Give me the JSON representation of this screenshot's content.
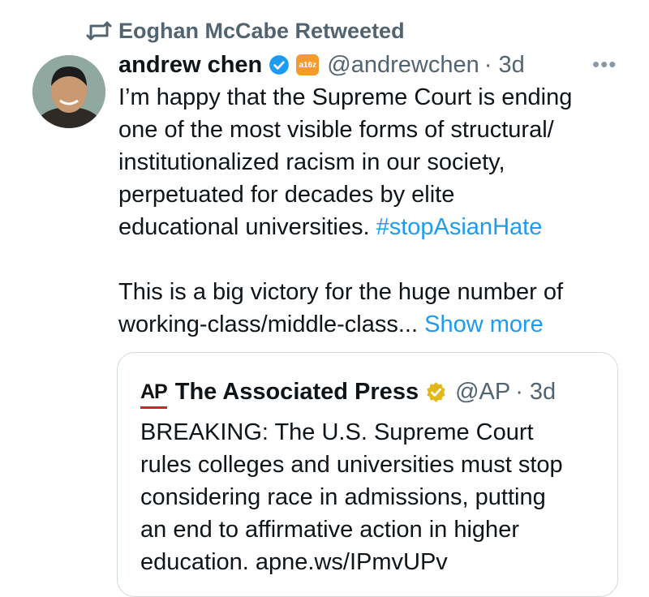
{
  "retweet": {
    "label": "Eoghan McCabe Retweeted"
  },
  "tweet": {
    "author_name": "andrew chen",
    "org_badge": "a16z",
    "handle": "@andrewchen",
    "time": "· 3d",
    "more": "•••",
    "lines": [
      "I’m happy that the Supreme Court is ending",
      "one of the most visible forms of structural/",
      "institutionalized racism in our society,",
      "perpetuated for decades by elite"
    ],
    "line5_text": "educational universities.",
    "hashtag": "#stopAsianHate",
    "line6": "This is a big victory for the huge number of",
    "line7_text": "working-class/middle-class...",
    "show_more": "Show more"
  },
  "quote": {
    "logo": "AP",
    "name": "The Associated Press",
    "handle": "@AP",
    "time": "· 3d",
    "lines": [
      "BREAKING: The U.S. Supreme Court",
      "rules colleges and universities must stop",
      "considering race in admissions, putting",
      "an end to affirmative action in higher",
      "education. apne.ws/IPmvUPv"
    ]
  },
  "colors": {
    "link": "#1d9bf0",
    "muted": "#536471",
    "verified_blue": "#1d9bf0",
    "verified_gold": "#e2b719"
  },
  "icons": {
    "retweet": "retweet-icon",
    "verified": "verified-badge-icon",
    "more": "more-icon"
  }
}
